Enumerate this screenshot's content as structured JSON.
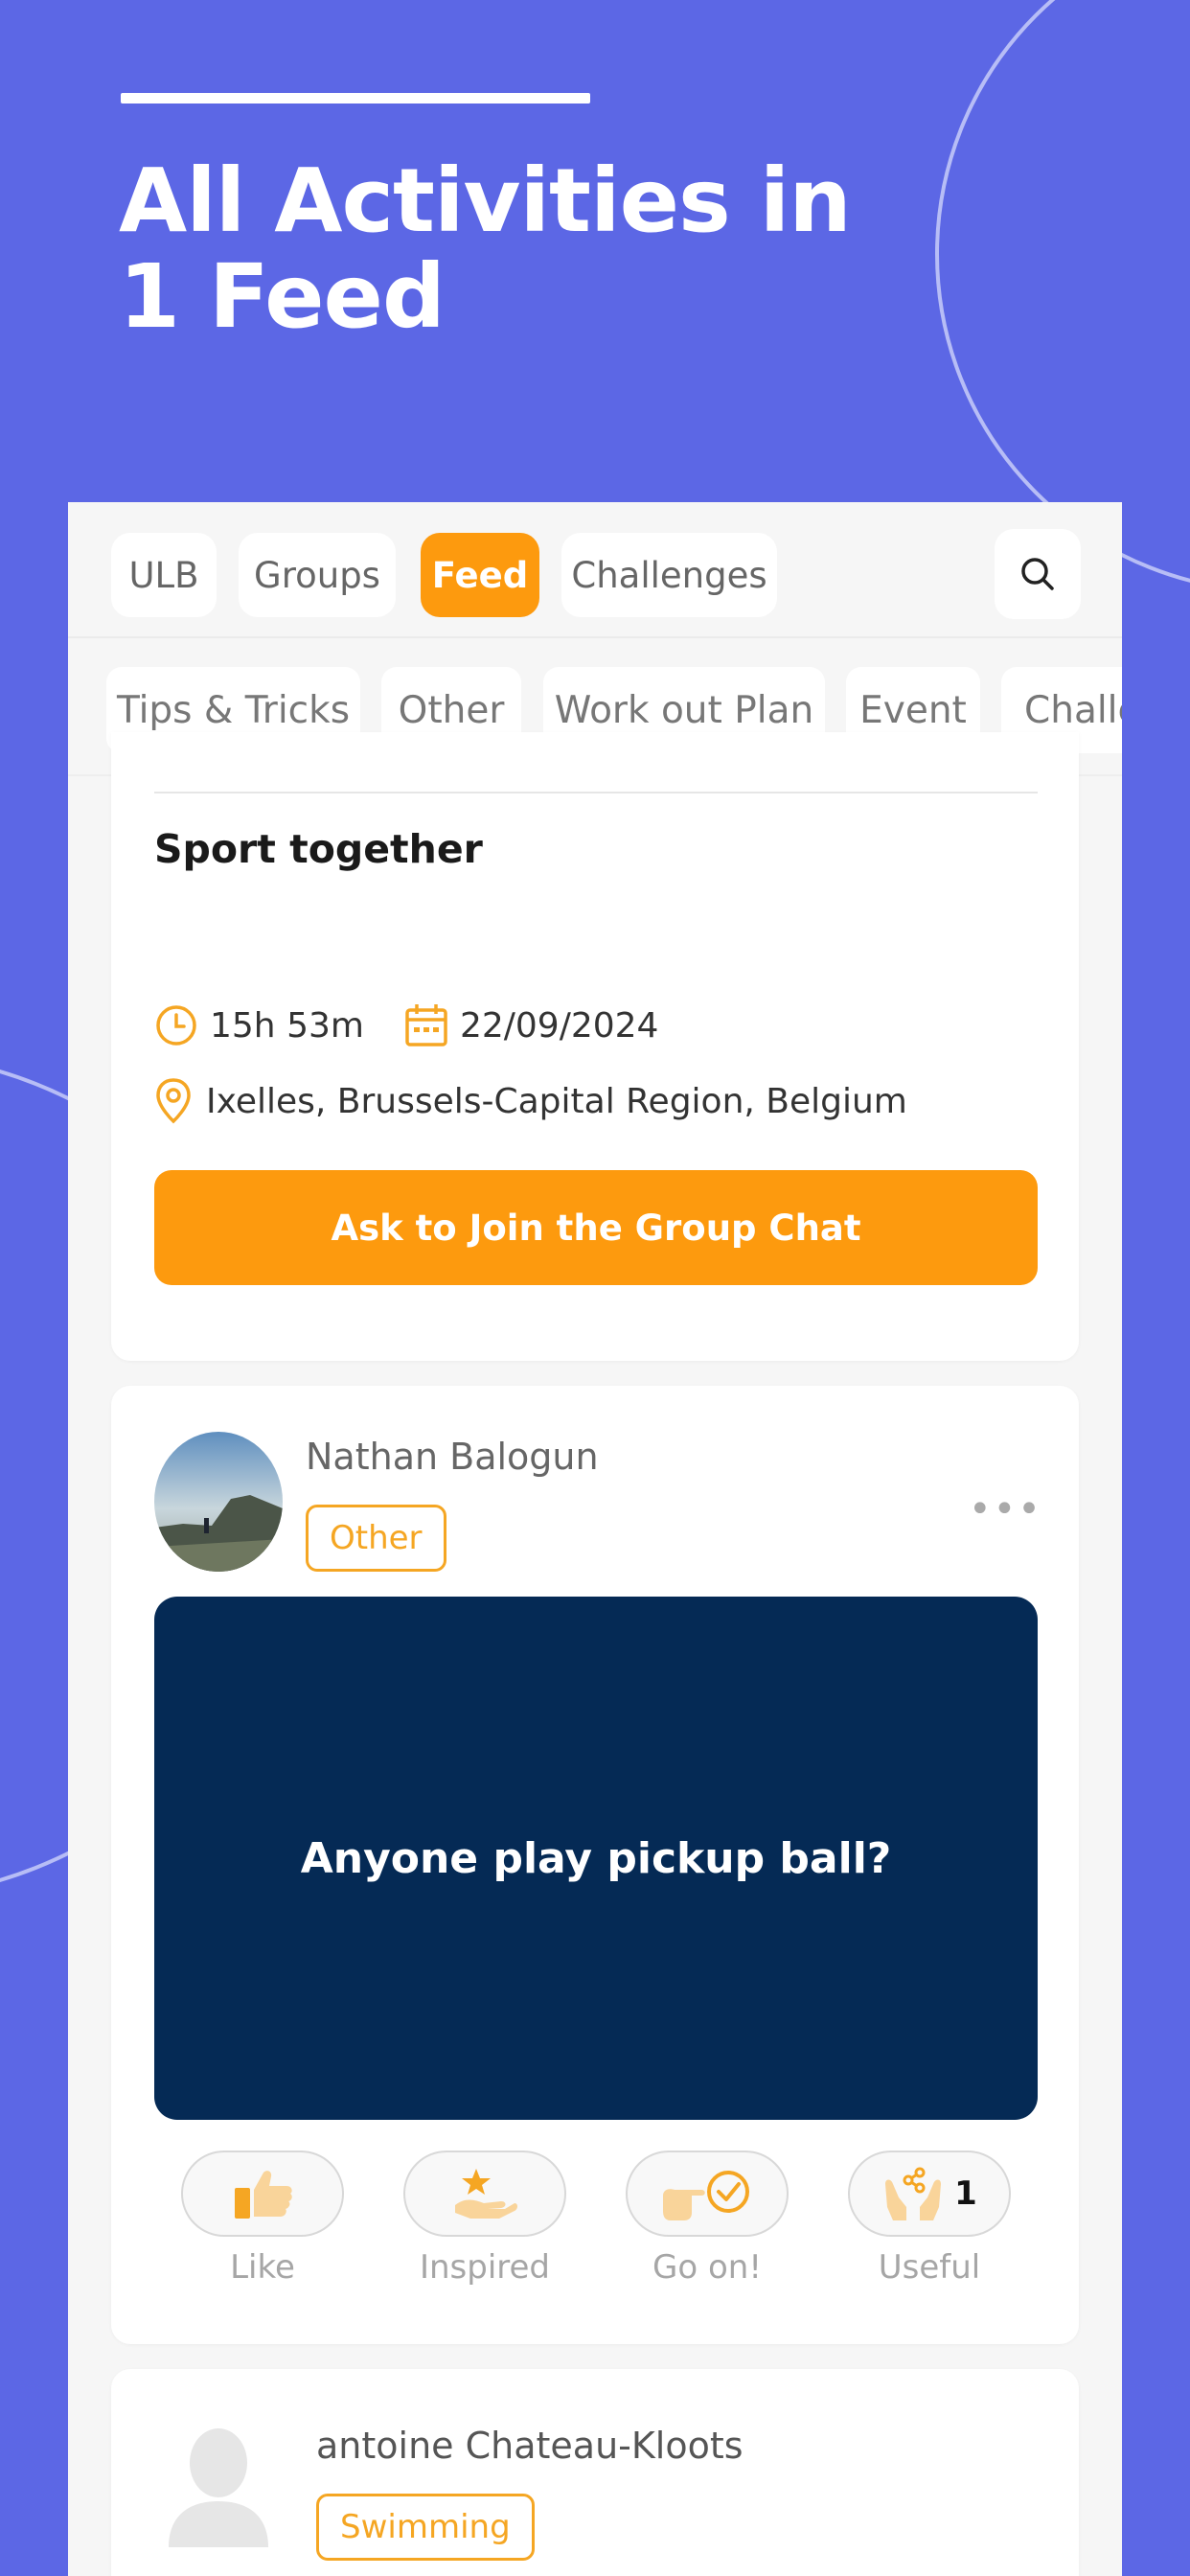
{
  "hero": {
    "title": "All Activities in\n1 Feed"
  },
  "nav": {
    "tabs": [
      {
        "label": "ULB",
        "active": false
      },
      {
        "label": "Groups",
        "active": false
      },
      {
        "label": "Feed",
        "active": true
      },
      {
        "label": "Challenges",
        "active": false
      }
    ],
    "search_icon": "search-icon"
  },
  "categories": [
    "Tips & Tricks",
    "Other",
    "Work out Plan",
    "Event",
    "Challenges"
  ],
  "post1": {
    "title": "Sport together",
    "duration": "15h 53m",
    "date": "22/09/2024",
    "location": "Ixelles, Brussels-Capital Region, Belgium",
    "button_label": "Ask to Join the Group Chat"
  },
  "post2": {
    "author": "Nathan Balogun",
    "tag": "Other",
    "message": "Anyone play pickup ball?",
    "reactions": [
      {
        "label": "Like",
        "icon": "thumbs-up-icon",
        "count": ""
      },
      {
        "label": "Inspired",
        "icon": "star-hand-icon",
        "count": ""
      },
      {
        "label": "Go on!",
        "icon": "pointing-check-icon",
        "count": ""
      },
      {
        "label": "Useful",
        "icon": "share-hands-icon",
        "count": "1"
      }
    ]
  },
  "post3": {
    "author": "antoine Chateau-Kloots",
    "tag": "Swimming"
  },
  "colors": {
    "background": "#5c67e5",
    "accent": "#fd9a0e",
    "tag_border": "#f5a623",
    "media_background": "#052a55"
  }
}
